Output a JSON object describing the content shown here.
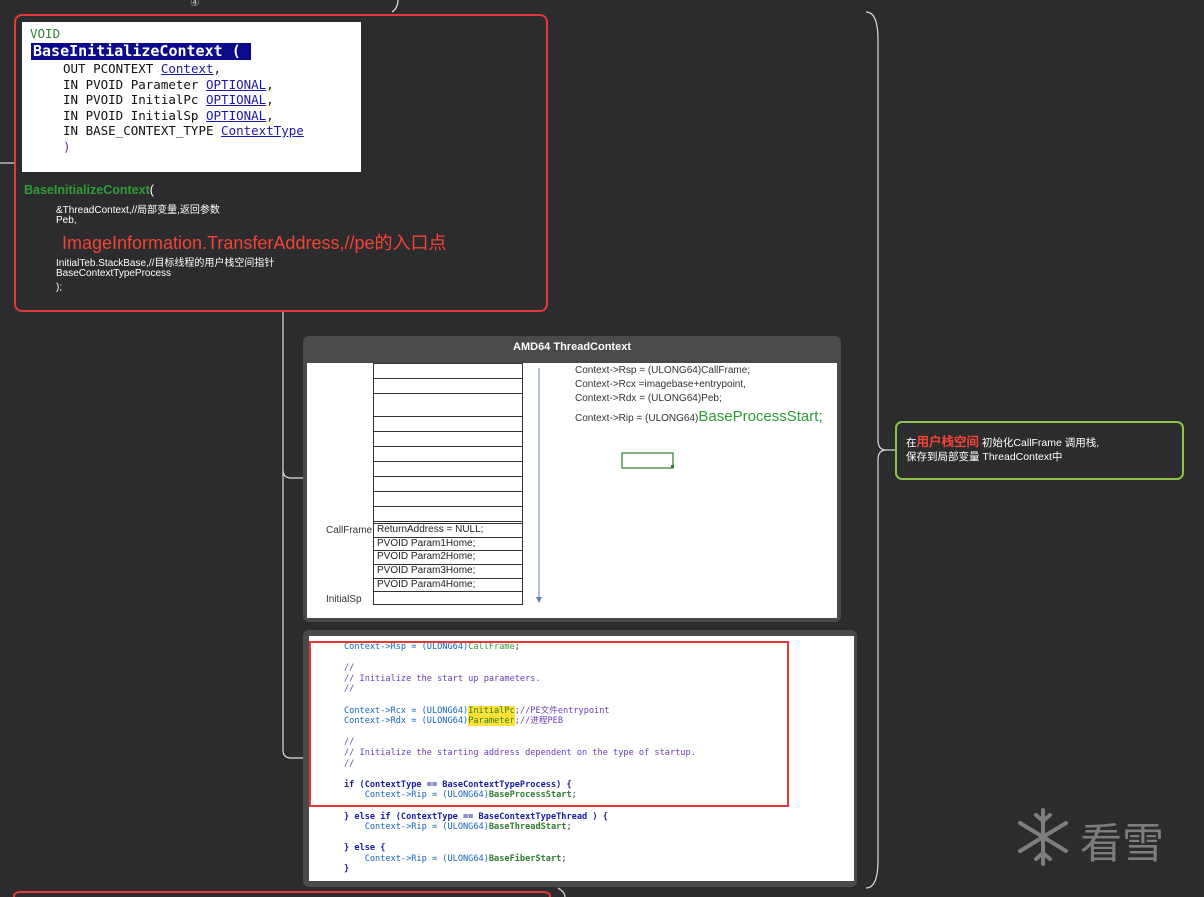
{
  "marker": "④",
  "signature": {
    "ret_type": "VOID",
    "func_name": "BaseInitializeContext",
    "open_paren": "(",
    "params": [
      {
        "prefix": "OUT PCONTEXT ",
        "name": "Context",
        "suffix": ","
      },
      {
        "prefix": "IN PVOID Parameter ",
        "name": "OPTIONAL",
        "suffix": ","
      },
      {
        "prefix": "IN PVOID InitialPc ",
        "name": "OPTIONAL",
        "suffix": ","
      },
      {
        "prefix": "IN PVOID InitialSp ",
        "name": "OPTIONAL",
        "suffix": ","
      },
      {
        "prefix": "IN BASE_CONTEXT_TYPE ",
        "name": "ContextType",
        "suffix": ""
      }
    ],
    "close_paren": ")"
  },
  "call": {
    "func_name": "BaseInitializeContext",
    "open": "(",
    "lines": [
      "&ThreadContext,//局部变量,返回参数",
      "Peb,"
    ],
    "highlight_line": "ImageInformation.TransferAddress,//pe的入口点",
    "lines_after": [
      "InitialTeb.StackBase,//目标线程的用户栈空间指针",
      "BaseContextTypeProcess",
      ");"
    ]
  },
  "thread_context": {
    "title": "AMD64  ThreadContext",
    "callframe_label": "CallFrame",
    "initialsp_label": "InitialSp",
    "frame_rows": [
      "ReturnAddress = NULL;",
      " PVOID Param1Home;",
      "PVOID Param2Home;",
      "PVOID Param3Home;",
      " PVOID Param4Home;"
    ],
    "ctx_lines": [
      "Context->Rsp = (ULONG64)CallFrame;",
      "Context->Rcx =imagebase+entrypoint,",
      "Context->Rdx = (ULONG64)Peb;"
    ],
    "rip_prefix": "Context->Rip = (ULONG64)",
    "rip_value": "BaseProcessStart;"
  },
  "code": {
    "l1a": "Context->Rsp = (ULONG64)",
    "l1b": "CallFrame",
    "l1c": ";",
    "c1": "//",
    "c2": "// Initialize the start up parameters.",
    "c3": "//",
    "l2a": "Context->Rcx = (ULONG64)",
    "l2b": "InitialPc",
    "l2c": ";//PE文件entrypoint",
    "l3a": "Context->Rdx = (ULONG64)",
    "l3b": "Parameter",
    "l3c": ";//进程PEB",
    "c4": "//",
    "c5": "// Initialize the starting address dependent on the type of startup.",
    "c6": "//",
    "if1": "if (ContextType == BaseContextTypeProcess) {",
    "rip1a": "    Context->Rip = (ULONG64)",
    "rip1b": "BaseProcessStart",
    "rip1c": ";",
    "if2": "} else if (ContextType == BaseContextTypeThread ) {",
    "rip2a": "    Context->Rip = (ULONG64)",
    "rip2b": "BaseThreadStart",
    "rip2c": ";",
    "else": "} else {",
    "rip3a": "    Context->Rip = (ULONG64)",
    "rip3b": "BaseFiberStart",
    "rip3c": ";",
    "close": "}"
  },
  "note": {
    "pre": "在",
    "emph": "用户栈空间",
    "post": " 初始化CallFrame 调用栈,",
    "line2": "保存到局部变量 ThreadContext中"
  },
  "watermark": "看雪",
  "colors": {
    "red": "#e53935",
    "green_border": "#8bc34a",
    "background": "#2c2c2e"
  }
}
